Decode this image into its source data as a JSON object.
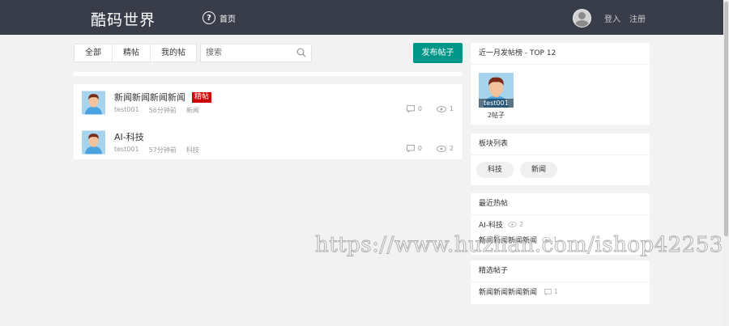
{
  "header": {
    "logo": "酷码世界",
    "nav_home": "首页",
    "login": "登入",
    "register": "注册"
  },
  "filters": {
    "tabs": [
      "全部",
      "精帖",
      "我的帖"
    ],
    "search_placeholder": "搜索",
    "post_button": "发布帖子"
  },
  "posts": [
    {
      "title": "新闻新闻新闻新闻",
      "badge": "精帖",
      "author": "test001",
      "time": "56分钟前",
      "category": "新闻",
      "comments": "0",
      "views": "1"
    },
    {
      "title": "AI-科技",
      "badge": "",
      "author": "test001",
      "time": "57分钟前",
      "category": "科技",
      "comments": "0",
      "views": "2"
    }
  ],
  "top_posters": {
    "title": "近一月发帖榜 - TOP 12",
    "users": [
      {
        "name": "test001",
        "count": "2帖子"
      }
    ]
  },
  "blocks": {
    "title": "板块列表",
    "items": [
      "科技",
      "新闻"
    ]
  },
  "hot_posts": {
    "title": "最近热帖",
    "items": [
      {
        "title": "AI-科技",
        "views": "2"
      },
      {
        "title": "新闻新闻新闻新闻",
        "views": "1"
      }
    ]
  },
  "picked_posts": {
    "title": "精选帖子",
    "items": [
      {
        "title": "新闻新闻新闻新闻",
        "comments": "1"
      }
    ]
  },
  "watermark": "https://www.huzhan.com/ishop42253",
  "colors": {
    "header_bg": "#393d49",
    "accent": "#009688",
    "badge": "#cc0000"
  }
}
